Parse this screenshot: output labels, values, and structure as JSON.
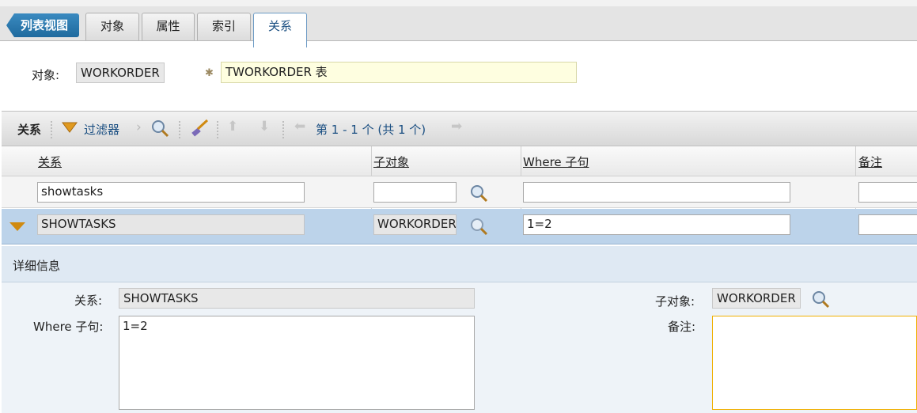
{
  "tabs": {
    "back_label": "列表视图",
    "items": [
      {
        "label": "对象"
      },
      {
        "label": "属性"
      },
      {
        "label": "索引"
      },
      {
        "label": "关系"
      }
    ]
  },
  "header": {
    "object_label": "对象:",
    "object_value": "WORKORDER",
    "description_value": "TWORKORDER 表"
  },
  "table": {
    "title": "关系",
    "filter_label": "过滤器",
    "pagination": "第 1 - 1 个  (共 1 个)",
    "columns": [
      "关系",
      "子对象",
      "Where 子句",
      "备注"
    ],
    "filter_values": {
      "relationship": "showtasks",
      "child": "",
      "where": "",
      "remarks": ""
    },
    "rows": [
      {
        "relationship": "SHOWTASKS",
        "child": "WORKORDER",
        "where": "1=2",
        "remarks": ""
      }
    ]
  },
  "detail": {
    "title": "详细信息",
    "relationship_label": "关系:",
    "relationship_value": "SHOWTASKS",
    "where_label": "Where 子句:",
    "where_value": "1=2",
    "child_label": "子对象:",
    "child_value": "WORKORDER",
    "remarks_label": "备注:",
    "remarks_value": ""
  },
  "colors": {
    "accent": "#1f6a9e",
    "selected_row": "#bcd3ea",
    "required_field": "#fefee0",
    "highlight_border": "#f0b000"
  }
}
